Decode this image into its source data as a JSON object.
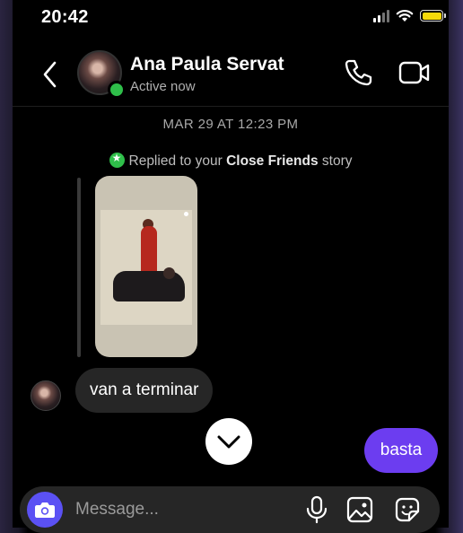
{
  "status_bar": {
    "time": "20:42",
    "battery_level": 1.0,
    "battery_color": "#f5d90a"
  },
  "header": {
    "contact_name": "Ana Paula Servat",
    "status": "Active now",
    "online_color": "#2fbf4a",
    "icons": [
      "back-arrow-icon",
      "phone-icon",
      "video-camera-icon"
    ]
  },
  "conversation": {
    "timestamp": "MAR 29 AT 12:23 PM",
    "story_reply": {
      "prefix": "Replied to your",
      "emphasis": "Close Friends",
      "suffix": "story"
    },
    "incoming_message": "van a terminar",
    "outgoing_message": "basta",
    "accent_color": "#6c3df0"
  },
  "composer": {
    "placeholder": "Message...",
    "icons": [
      "camera-icon",
      "microphone-icon",
      "gallery-icon",
      "sticker-icon"
    ]
  }
}
